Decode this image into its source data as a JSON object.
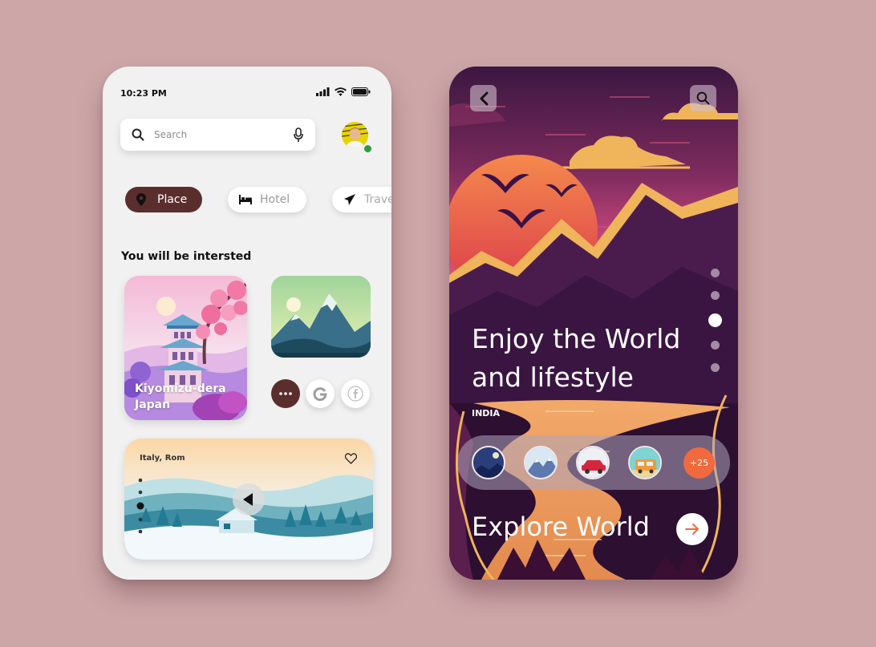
{
  "left_screen": {
    "status": {
      "time": "10:23 PM"
    },
    "search": {
      "placeholder": "Search"
    },
    "chips": [
      {
        "label": "Place",
        "icon": "location-pin-icon",
        "active": true
      },
      {
        "label": "Hotel",
        "icon": "bed-icon",
        "active": false
      },
      {
        "label": "Travel",
        "icon": "airplane-icon",
        "active": false
      }
    ],
    "section_title": "You will be intersted",
    "cards": {
      "kiyomizu": {
        "line1": "Kiyomizu-dera",
        "line2": "Japan"
      },
      "italy": {
        "label": "Italy, Rom"
      }
    },
    "colors": {
      "accent": "#5a2e2d",
      "background": "#f2f1f1"
    }
  },
  "right_screen": {
    "hero_line1": "Enjoy the World",
    "hero_line2": "and lifestyle",
    "country": "INDIA",
    "more_count": "+25",
    "explore_label": "Explore World",
    "active_page": 3,
    "page_count": 5,
    "colors": {
      "accent": "#f06a3e",
      "sky_top": "#3a1840",
      "sun": "#e8613a"
    }
  }
}
